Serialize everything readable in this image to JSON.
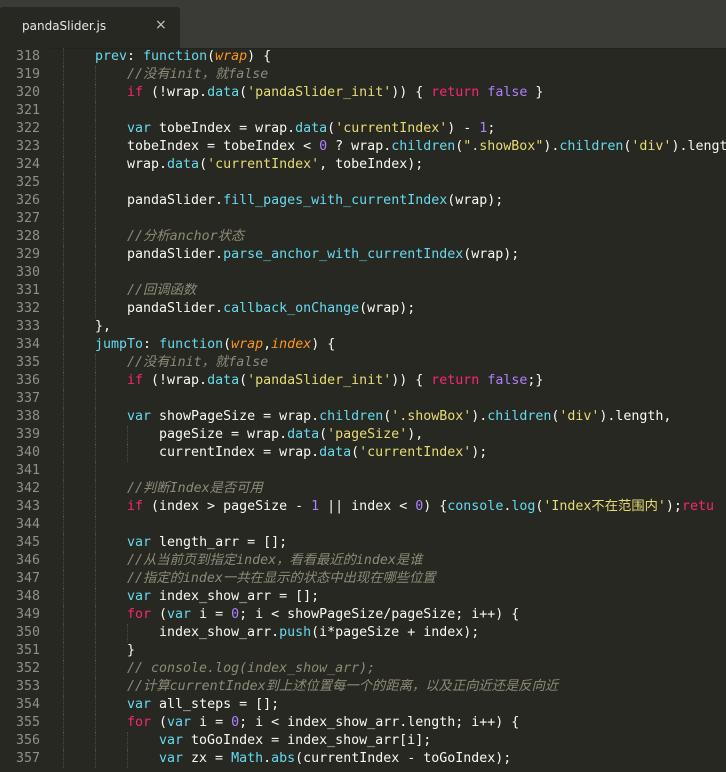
{
  "tab": {
    "title": "pandaSlider.js",
    "close": "×"
  },
  "colors": {
    "background": "#272822",
    "keyword": "#f92672",
    "function": "#66d9ef",
    "string": "#e6db74",
    "number": "#ae81ff",
    "comment": "#8d8a78",
    "parameter": "#fd971f",
    "plain": "#f8f8f2"
  },
  "code_lines": [
    {
      "n": "318",
      "i": 1,
      "t": [
        [
          "func",
          "prev"
        ],
        [
          "plain",
          ": "
        ],
        [
          "func",
          "function"
        ],
        [
          "plain",
          "("
        ],
        [
          "param",
          "wrap"
        ],
        [
          "plain",
          ") {"
        ]
      ]
    },
    {
      "n": "319",
      "i": 2,
      "t": [
        [
          "cmt",
          "//没有init，就false"
        ]
      ]
    },
    {
      "n": "320",
      "i": 2,
      "t": [
        [
          "kw",
          "if"
        ],
        [
          "plain",
          " (!wrap."
        ],
        [
          "method",
          "data"
        ],
        [
          "plain",
          "("
        ],
        [
          "str",
          "'pandaSlider_init'"
        ],
        [
          "plain",
          ")) { "
        ],
        [
          "kw",
          "return"
        ],
        [
          "plain",
          " "
        ],
        [
          "const",
          "false"
        ],
        [
          "plain",
          " }"
        ]
      ]
    },
    {
      "n": "321",
      "i": 2,
      "t": []
    },
    {
      "n": "322",
      "i": 2,
      "t": [
        [
          "func",
          "var"
        ],
        [
          "plain",
          " tobeIndex = wrap."
        ],
        [
          "method",
          "data"
        ],
        [
          "plain",
          "("
        ],
        [
          "str",
          "'currentIndex'"
        ],
        [
          "plain",
          ") - "
        ],
        [
          "num",
          "1"
        ],
        [
          "plain",
          ";"
        ]
      ]
    },
    {
      "n": "323",
      "i": 2,
      "t": [
        [
          "plain",
          "tobeIndex = tobeIndex < "
        ],
        [
          "num",
          "0"
        ],
        [
          "plain",
          " ? wrap."
        ],
        [
          "method",
          "children"
        ],
        [
          "plain",
          "("
        ],
        [
          "str",
          "\".showBox\""
        ],
        [
          "plain",
          ")."
        ],
        [
          "method",
          "children"
        ],
        [
          "plain",
          "("
        ],
        [
          "str",
          "'div'"
        ],
        [
          "plain",
          ").length"
        ]
      ]
    },
    {
      "n": "324",
      "i": 2,
      "t": [
        [
          "plain",
          "wrap."
        ],
        [
          "method",
          "data"
        ],
        [
          "plain",
          "("
        ],
        [
          "str",
          "'currentIndex'"
        ],
        [
          "plain",
          ", tobeIndex);"
        ]
      ]
    },
    {
      "n": "325",
      "i": 2,
      "t": []
    },
    {
      "n": "326",
      "i": 2,
      "t": [
        [
          "plain",
          "pandaSlider."
        ],
        [
          "method",
          "fill_pages_with_currentIndex"
        ],
        [
          "plain",
          "(wrap);"
        ]
      ]
    },
    {
      "n": "327",
      "i": 2,
      "t": []
    },
    {
      "n": "328",
      "i": 2,
      "t": [
        [
          "cmt",
          "//分析anchor状态"
        ]
      ]
    },
    {
      "n": "329",
      "i": 2,
      "t": [
        [
          "plain",
          "pandaSlider."
        ],
        [
          "method",
          "parse_anchor_with_currentIndex"
        ],
        [
          "plain",
          "(wrap);"
        ]
      ]
    },
    {
      "n": "330",
      "i": 2,
      "t": []
    },
    {
      "n": "331",
      "i": 2,
      "t": [
        [
          "cmt",
          "//回调函数"
        ]
      ]
    },
    {
      "n": "332",
      "i": 2,
      "t": [
        [
          "plain",
          "pandaSlider."
        ],
        [
          "method",
          "callback_onChange"
        ],
        [
          "plain",
          "(wrap);"
        ]
      ]
    },
    {
      "n": "333",
      "i": 1,
      "t": [
        [
          "plain",
          "},"
        ]
      ]
    },
    {
      "n": "334",
      "i": 1,
      "t": [
        [
          "func",
          "jumpTo"
        ],
        [
          "plain",
          ": "
        ],
        [
          "func",
          "function"
        ],
        [
          "plain",
          "("
        ],
        [
          "param",
          "wrap"
        ],
        [
          "plain",
          ","
        ],
        [
          "param",
          "index"
        ],
        [
          "plain",
          ") {"
        ]
      ]
    },
    {
      "n": "335",
      "i": 2,
      "t": [
        [
          "cmt",
          "//没有init，就false"
        ]
      ]
    },
    {
      "n": "336",
      "i": 2,
      "t": [
        [
          "kw",
          "if"
        ],
        [
          "plain",
          " (!wrap."
        ],
        [
          "method",
          "data"
        ],
        [
          "plain",
          "("
        ],
        [
          "str",
          "'pandaSlider_init'"
        ],
        [
          "plain",
          ")) { "
        ],
        [
          "kw",
          "return"
        ],
        [
          "plain",
          " "
        ],
        [
          "const",
          "false"
        ],
        [
          "plain",
          ";}"
        ]
      ]
    },
    {
      "n": "337",
      "i": 2,
      "t": []
    },
    {
      "n": "338",
      "i": 2,
      "t": [
        [
          "func",
          "var"
        ],
        [
          "plain",
          " showPageSize = wrap."
        ],
        [
          "method",
          "children"
        ],
        [
          "plain",
          "("
        ],
        [
          "str",
          "'.showBox'"
        ],
        [
          "plain",
          ")."
        ],
        [
          "method",
          "children"
        ],
        [
          "plain",
          "("
        ],
        [
          "str",
          "'div'"
        ],
        [
          "plain",
          ").length,"
        ]
      ]
    },
    {
      "n": "339",
      "i": 3,
      "t": [
        [
          "plain",
          "pageSize = wrap."
        ],
        [
          "method",
          "data"
        ],
        [
          "plain",
          "("
        ],
        [
          "str",
          "'pageSize'"
        ],
        [
          "plain",
          "),"
        ]
      ]
    },
    {
      "n": "340",
      "i": 3,
      "t": [
        [
          "plain",
          "currentIndex = wrap."
        ],
        [
          "method",
          "data"
        ],
        [
          "plain",
          "("
        ],
        [
          "str",
          "'currentIndex'"
        ],
        [
          "plain",
          ");"
        ]
      ]
    },
    {
      "n": "341",
      "i": 2,
      "t": []
    },
    {
      "n": "342",
      "i": 2,
      "t": [
        [
          "cmt",
          "//判断Index是否可用"
        ]
      ]
    },
    {
      "n": "343",
      "i": 2,
      "t": [
        [
          "kw",
          "if"
        ],
        [
          "plain",
          " (index > pageSize - "
        ],
        [
          "num",
          "1"
        ],
        [
          "plain",
          " || index < "
        ],
        [
          "num",
          "0"
        ],
        [
          "plain",
          ") {"
        ],
        [
          "builtin",
          "console"
        ],
        [
          "plain",
          "."
        ],
        [
          "method",
          "log"
        ],
        [
          "plain",
          "("
        ],
        [
          "str",
          "'Index不在范围内'"
        ],
        [
          "plain",
          ");"
        ],
        [
          "kw",
          "retu"
        ]
      ]
    },
    {
      "n": "344",
      "i": 2,
      "t": []
    },
    {
      "n": "345",
      "i": 2,
      "t": [
        [
          "func",
          "var"
        ],
        [
          "plain",
          " length_arr = [];"
        ]
      ]
    },
    {
      "n": "346",
      "i": 2,
      "t": [
        [
          "cmt",
          "//从当前页到指定index，看看最近的index是谁"
        ]
      ]
    },
    {
      "n": "347",
      "i": 2,
      "t": [
        [
          "cmt",
          "//指定的index一共在显示的状态中出现在哪些位置"
        ]
      ]
    },
    {
      "n": "348",
      "i": 2,
      "t": [
        [
          "func",
          "var"
        ],
        [
          "plain",
          " index_show_arr = [];"
        ]
      ]
    },
    {
      "n": "349",
      "i": 2,
      "t": [
        [
          "kw",
          "for"
        ],
        [
          "plain",
          " ("
        ],
        [
          "func",
          "var"
        ],
        [
          "plain",
          " i = "
        ],
        [
          "num",
          "0"
        ],
        [
          "plain",
          "; i < showPageSize/pageSize; i++) {"
        ]
      ]
    },
    {
      "n": "350",
      "i": 3,
      "t": [
        [
          "plain",
          "index_show_arr."
        ],
        [
          "method",
          "push"
        ],
        [
          "plain",
          "(i*pageSize + index);"
        ]
      ]
    },
    {
      "n": "351",
      "i": 2,
      "t": [
        [
          "plain",
          "}"
        ]
      ]
    },
    {
      "n": "352",
      "i": 2,
      "t": [
        [
          "cmt",
          "// console.log(index_show_arr);"
        ]
      ]
    },
    {
      "n": "353",
      "i": 2,
      "t": [
        [
          "cmt",
          "//计算currentIndex到上述位置每一个的距离，以及正向近还是反向近"
        ]
      ]
    },
    {
      "n": "354",
      "i": 2,
      "t": [
        [
          "func",
          "var"
        ],
        [
          "plain",
          " all_steps = [];"
        ]
      ]
    },
    {
      "n": "355",
      "i": 2,
      "t": [
        [
          "kw",
          "for"
        ],
        [
          "plain",
          " ("
        ],
        [
          "func",
          "var"
        ],
        [
          "plain",
          " i = "
        ],
        [
          "num",
          "0"
        ],
        [
          "plain",
          "; i < index_show_arr.length; i++) {"
        ]
      ]
    },
    {
      "n": "356",
      "i": 3,
      "t": [
        [
          "func",
          "var"
        ],
        [
          "plain",
          " toGoIndex = index_show_arr[i];"
        ]
      ]
    },
    {
      "n": "357",
      "i": 3,
      "t": [
        [
          "func",
          "var"
        ],
        [
          "plain",
          " zx = "
        ],
        [
          "builtin",
          "Math"
        ],
        [
          "plain",
          "."
        ],
        [
          "method",
          "abs"
        ],
        [
          "plain",
          "(currentIndex - toGoIndex);"
        ]
      ]
    }
  ]
}
